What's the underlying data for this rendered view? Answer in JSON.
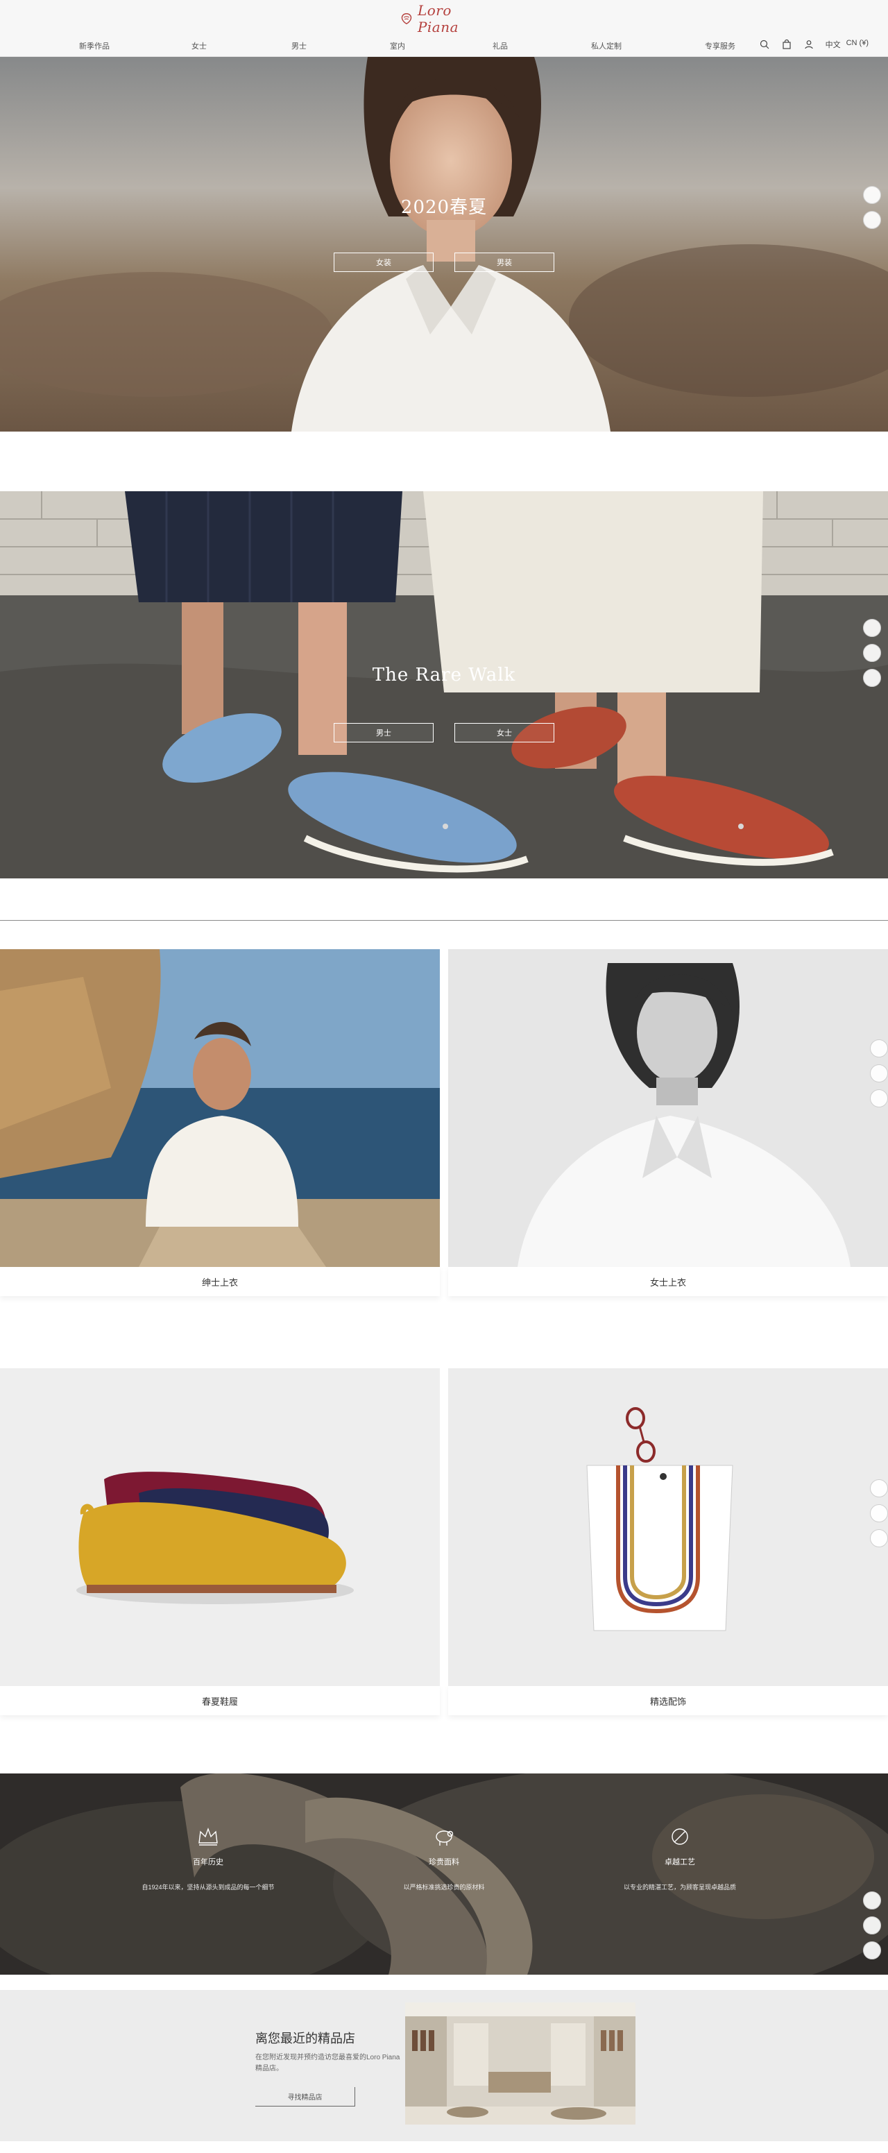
{
  "header": {
    "brand": "Loro Piana",
    "nav": [
      "新季作品",
      "女士",
      "男士",
      "室内",
      "礼品",
      "私人定制",
      "专享服务"
    ],
    "lang": "中文",
    "region": "CN (¥)"
  },
  "hero": {
    "title": "2020春夏",
    "cta": [
      "女装",
      "男装"
    ],
    "badges": [
      "",
      ""
    ]
  },
  "rare_walk": {
    "title": "The Rare Walk",
    "cta": [
      "男士",
      "女士"
    ],
    "badges": [
      "",
      "",
      ""
    ]
  },
  "tiles_row1": [
    {
      "label": "绅士上衣"
    },
    {
      "label": "女士上衣"
    }
  ],
  "tiles_row2": [
    {
      "label": "春夏鞋履"
    },
    {
      "label": "精选配饰"
    }
  ],
  "values": [
    {
      "title": "百年历史",
      "desc": "自1924年以来，坚持从源头到成品的每一个细节"
    },
    {
      "title": "珍贵面料",
      "desc": "以严格标准挑选珍贵的原材料"
    },
    {
      "title": "卓越工艺",
      "desc": "以专业的精湛工艺，为顾客呈现卓越品质"
    }
  ],
  "store": {
    "title": "离您最近的精品店",
    "desc": "在您附近发现并预约造访您最喜爱的Loro Piana精品店。",
    "button": "寻找精品店"
  },
  "colors": {
    "brand": "#b5413e",
    "header_bg": "#f7f7f7",
    "store_bg": "#ececec"
  }
}
